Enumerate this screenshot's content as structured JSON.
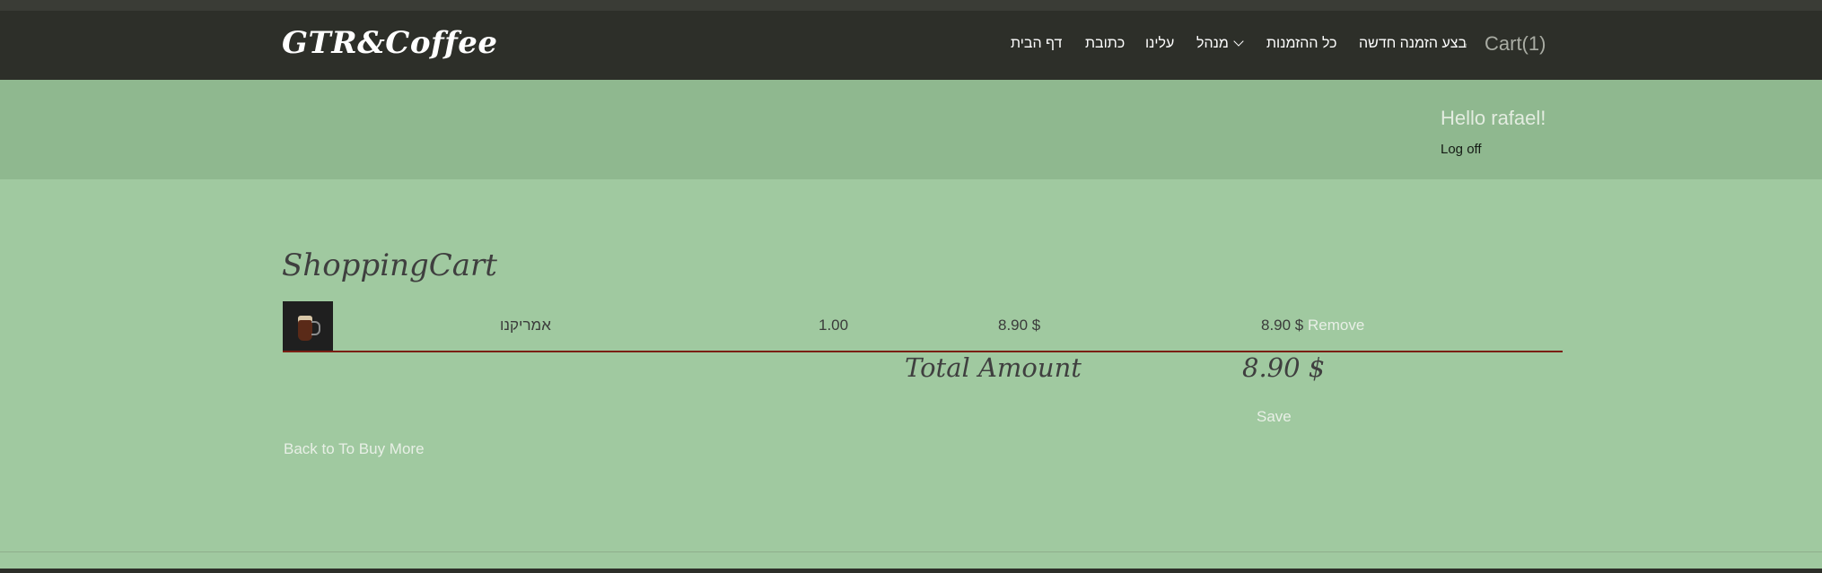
{
  "brand": "GTR&Coffee",
  "nav": {
    "items": [
      {
        "label": "דף הבית"
      },
      {
        "label": "כתובת"
      },
      {
        "label": "עלינו"
      },
      {
        "label": "מנהל"
      },
      {
        "label": "כל ההזמנות"
      },
      {
        "label": "בצע הזמנה חדשה"
      }
    ],
    "cart": "Cart(1)"
  },
  "user": {
    "greeting": "Hello rafael!",
    "logoff": "Log off"
  },
  "cart": {
    "title": "ShoppingCart",
    "items": [
      {
        "name": "אמריקנו",
        "quantity": "1.00",
        "unit_price": "8.90 $",
        "line_total": "8.90 $",
        "remove": "Remove",
        "image_icon": "coffee-cup-icon"
      }
    ],
    "total_label": "Total Amount",
    "total_value": "8.90 $",
    "save": "Save",
    "back": "Back to To Buy More"
  },
  "colors": {
    "navbar": "#2d2f29",
    "hero": "#8fb88f",
    "page": "#a0c9a0",
    "divider": "#7a1f14",
    "link": "#e8efe6"
  }
}
